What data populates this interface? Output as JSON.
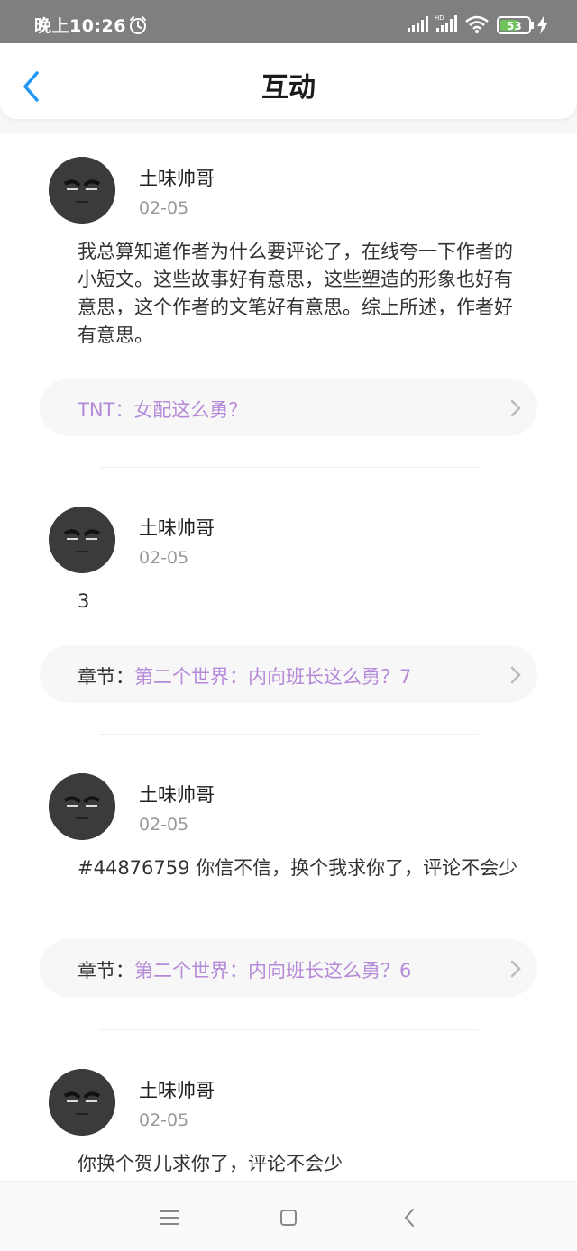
{
  "status": {
    "time": "晚上10:26",
    "battery": "53"
  },
  "header": {
    "title": "互动"
  },
  "posts": [
    {
      "user": "土味帅哥",
      "date": "02-05",
      "comment": "我总算知道作者为什么要评论了，在线夸一下作者的小短文。这些故事好有意思，这些塑造的形象也好有意思，这个作者的文笔好有意思。综上所述，作者好有意思。",
      "ref_prefix": "",
      "ref_text": "TNT：女配这么勇？"
    },
    {
      "user": "土味帅哥",
      "date": "02-05",
      "comment": "3",
      "ref_prefix": "章节：",
      "ref_text": "第二个世界：内向班长这么勇？7"
    },
    {
      "user": "土味帅哥",
      "date": "02-05",
      "comment": "#44876759 你信不信，换个我求你了，评论不会少",
      "ref_prefix": "章节：",
      "ref_text": "第二个世界：内向班长这么勇？6"
    },
    {
      "user": "土味帅哥",
      "date": "02-05",
      "comment": "你换个贺儿求你了，评论不会少",
      "ref_prefix": "",
      "ref_text": ""
    }
  ],
  "colors": {
    "accent": "#2196f3",
    "link": "#b58ad8",
    "status_bar": "#7f7f7f"
  },
  "icons": [
    "alarm-icon",
    "signal-icon",
    "wifi-icon",
    "battery-icon",
    "back-arrow-icon",
    "chevron-right-icon",
    "menu-icon",
    "home-icon",
    "back-nav-icon"
  ]
}
